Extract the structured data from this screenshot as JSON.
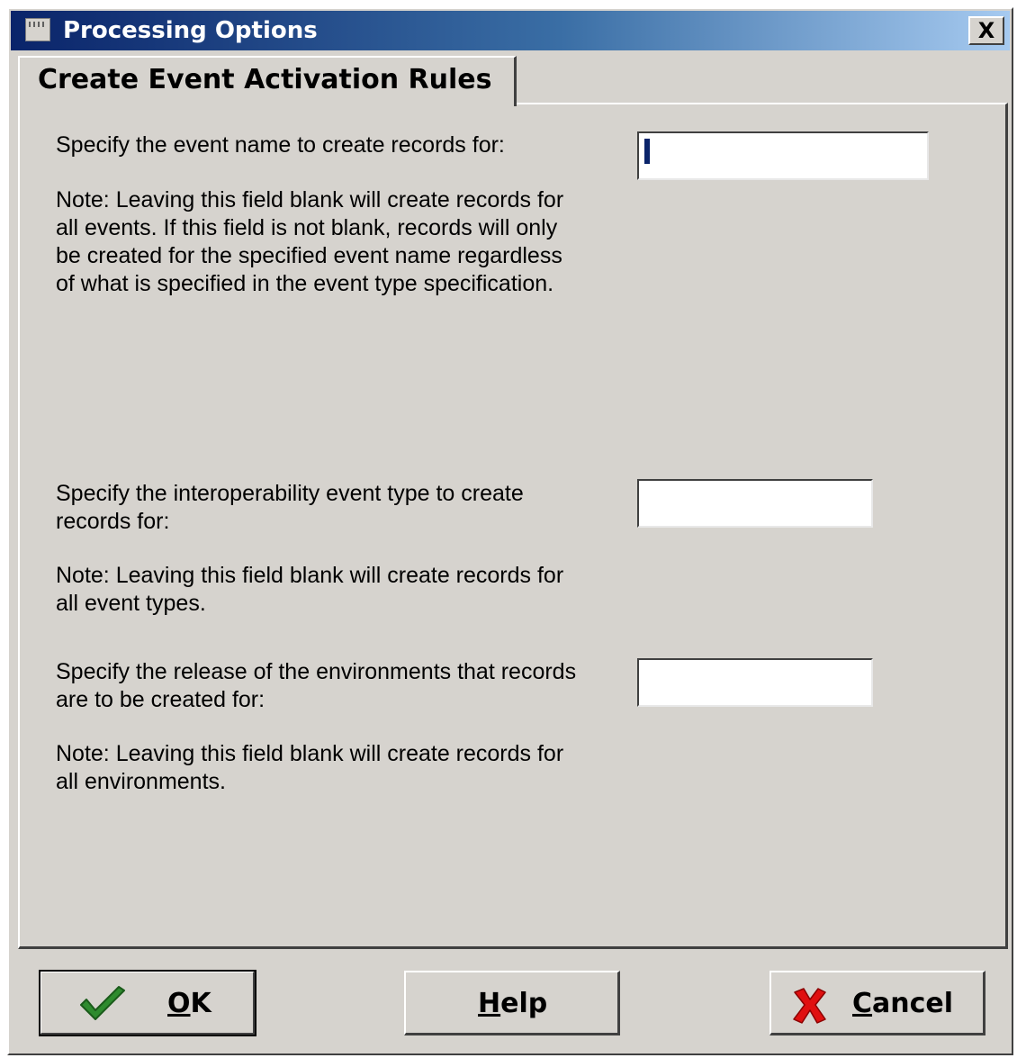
{
  "window": {
    "title": "Processing Options",
    "close_label": "X"
  },
  "tabs": [
    {
      "label": "Create Event Activation Rules",
      "active": true
    }
  ],
  "fields": [
    {
      "label": "Specify the event name to create records for:",
      "note": "Note: Leaving this field blank will create records for all events. If this field is not blank, records will only be created for the specified event name regardless of what is specified in the event type specification.",
      "value": ""
    },
    {
      "label": "Specify the interoperability event type to create records for:",
      "note": "Note: Leaving this field blank will create records for all event types.",
      "value": ""
    },
    {
      "label": "Specify the release of the environments that records are to be created for:",
      "note": "Note: Leaving this field blank will create records for all environments.",
      "value": ""
    }
  ],
  "buttons": {
    "ok": {
      "accel": "O",
      "rest": "K",
      "icon": "checkmark-icon",
      "color": "#2e8b2e"
    },
    "help": {
      "accel": "H",
      "rest": "elp"
    },
    "cancel": {
      "accel": "C",
      "rest": "ancel",
      "icon": "red-x-icon",
      "color": "#e01010"
    }
  },
  "colors": {
    "dialog_bg": "#d6d3ce",
    "title_gradient_start": "#0a246a",
    "title_gradient_end": "#a6caf0"
  }
}
